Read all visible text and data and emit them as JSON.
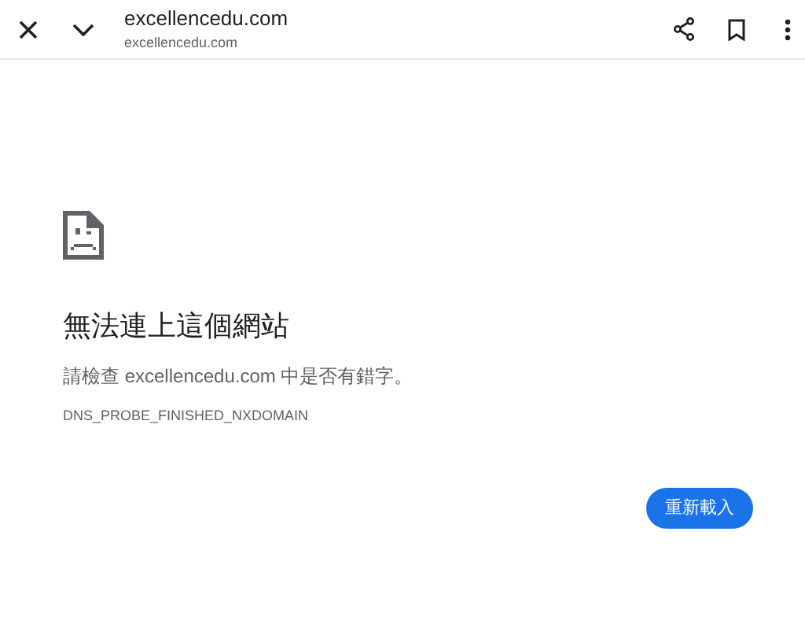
{
  "toolbar": {
    "title": "excellencedu.com",
    "url": "excellencedu.com"
  },
  "error": {
    "heading": "無法連上這個網站",
    "message": "請檢查 excellencedu.com 中是否有錯字。",
    "code": "DNS_PROBE_FINISHED_NXDOMAIN"
  },
  "buttons": [
    "重新載入"
  ]
}
